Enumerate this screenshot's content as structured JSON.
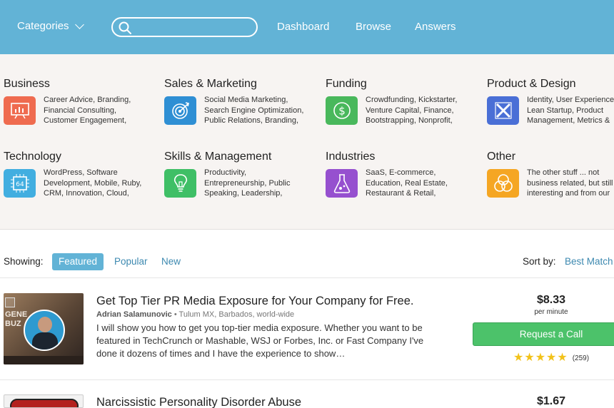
{
  "header": {
    "categories_label": "Categories",
    "search_placeholder": "",
    "nav": [
      "Dashboard",
      "Browse",
      "Answers"
    ]
  },
  "categories": [
    {
      "title": "Business",
      "desc": "Career Advice, Branding,\nFinancial Consulting,\nCustomer Engagement,",
      "icon": "presentation-chart-icon",
      "color": "#ef6b4f"
    },
    {
      "title": "Sales & Marketing",
      "desc": "Social Media Marketing,\nSearch Engine Optimization,\nPublic Relations, Branding,",
      "icon": "target-icon",
      "color": "#2f8fd4"
    },
    {
      "title": "Funding",
      "desc": "Crowdfunding, Kickstarter,\nVenture Capital, Finance,\nBootstrapping, Nonprofit,",
      "icon": "dollar-icon",
      "color": "#49b85c"
    },
    {
      "title": "Product & Design",
      "desc": "Identity, User Experience,\nLean Startup, Product\nManagement, Metrics &",
      "icon": "design-tools-icon",
      "color": "#4a6fd6"
    },
    {
      "title": "Technology",
      "desc": "WordPress, Software\nDevelopment, Mobile, Ruby,\nCRM, Innovation, Cloud,",
      "icon": "chip-icon",
      "color": "#42aee0",
      "icon_text": "64"
    },
    {
      "title": "Skills & Management",
      "desc": "Productivity,\nEntrepreneurship, Public\nSpeaking, Leadership,",
      "icon": "lightbulb-icon",
      "color": "#3fbf66"
    },
    {
      "title": "Industries",
      "desc": "SaaS, E-commerce,\nEducation, Real Estate,\nRestaurant & Retail,",
      "icon": "flask-icon",
      "color": "#9650cf"
    },
    {
      "title": "Other",
      "desc": "The other stuff ... not\nbusiness related, but still\ninteresting and from our",
      "icon": "circles-icon",
      "color": "#f5a623"
    }
  ],
  "filters": {
    "showing_label": "Showing:",
    "options": [
      "Featured",
      "Popular",
      "New"
    ],
    "active": "Featured",
    "sort_label": "Sort by:",
    "sort_value": "Best Match"
  },
  "listings": [
    {
      "title": "Get Top Tier PR Media Exposure for Your Company for Free.",
      "author": "Adrian Salamunovic",
      "location": "• Tulum MX, Barbados, world-wide",
      "description": "I will show you how to get you top-tier media exposure. Whether you want to be featured in TechCrunch or Mashable, WSJ or Forbes, Inc. or Fast Company I've done it dozens of times and I have the experience to show…",
      "thumb_text": "GENE BUZ",
      "price": "$8.33",
      "price_unit": "per minute",
      "cta": "Request a Call",
      "rating": 5,
      "reviews": "(259)"
    },
    {
      "title": "Narcissistic Personality Disorder Abuse",
      "price": "$1.67"
    }
  ],
  "colors": {
    "header": "#62b3d6",
    "accent": "#3d89b0",
    "cta": "#4cc26a",
    "star": "#f2c21a"
  }
}
